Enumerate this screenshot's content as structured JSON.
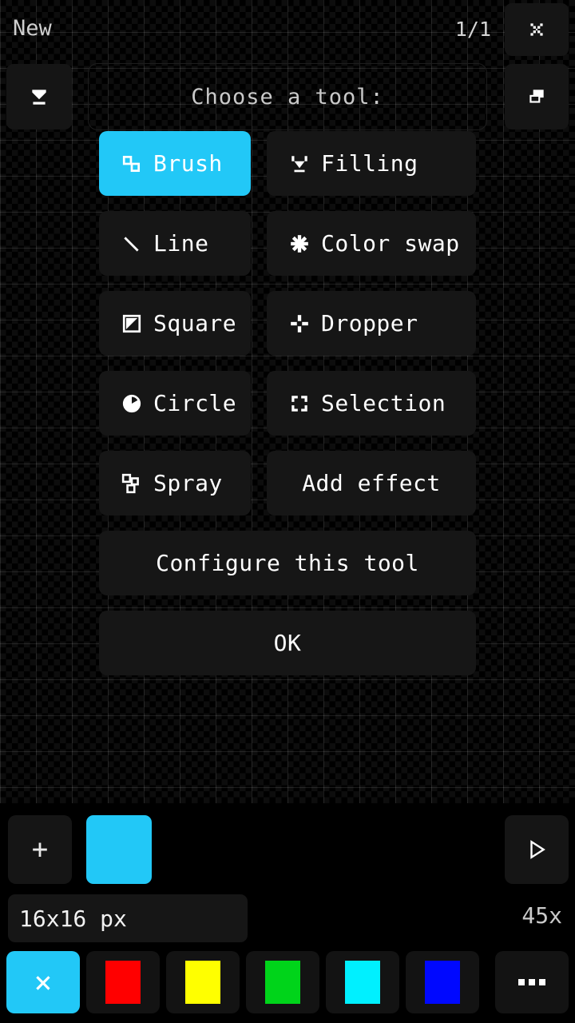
{
  "app": {
    "accent_color": "#22c8f7",
    "panel_color": "#161616",
    "background_color": "#000000"
  },
  "top_bar": {
    "document_title": "New",
    "frame_counter": "1/1",
    "close_label": "×",
    "close_icon": "close-icon",
    "layers_icon": "layers-icon",
    "export_icon": "collapse-download-icon"
  },
  "dialog": {
    "title": "Choose a tool:",
    "tools": [
      {
        "label": "Brush",
        "icon": "brush-icon",
        "selected": true
      },
      {
        "label": "Filling",
        "icon": "paint-bucket-icon",
        "selected": false
      },
      {
        "label": "Line",
        "icon": "line-icon",
        "selected": false
      },
      {
        "label": "Color swap",
        "icon": "asterisk-icon",
        "selected": false
      },
      {
        "label": "Square",
        "icon": "square-icon",
        "selected": false
      },
      {
        "label": "Dropper",
        "icon": "dropper-icon",
        "selected": false
      },
      {
        "label": "Circle",
        "icon": "circle-icon",
        "selected": false
      },
      {
        "label": "Selection",
        "icon": "selection-icon",
        "selected": false
      },
      {
        "label": "Spray",
        "icon": "spray-icon",
        "selected": false
      },
      {
        "label": "Add effect",
        "icon": "",
        "selected": false
      }
    ],
    "configure_label": "Configure this tool",
    "ok_label": "OK"
  },
  "bottom": {
    "add_frame_label": "+",
    "add_frame_icon": "plus-icon",
    "current_color": "#22c8f7",
    "play_icon": "play-icon",
    "canvas_size": "16x16  px",
    "zoom_level": "45x"
  },
  "palette": {
    "selected_mark": "×",
    "swatches": [
      {
        "color": "#22c8f7",
        "active": true,
        "name": "palette-swatch-cyan-selected"
      },
      {
        "color": "#ff0000",
        "active": false,
        "name": "palette-swatch-red"
      },
      {
        "color": "#ffff00",
        "active": false,
        "name": "palette-swatch-yellow"
      },
      {
        "color": "#00d41a",
        "active": false,
        "name": "palette-swatch-green"
      },
      {
        "color": "#00f0ff",
        "active": false,
        "name": "palette-swatch-aqua"
      },
      {
        "color": "#0008ff",
        "active": false,
        "name": "palette-swatch-blue"
      }
    ],
    "more_label": "•••"
  }
}
